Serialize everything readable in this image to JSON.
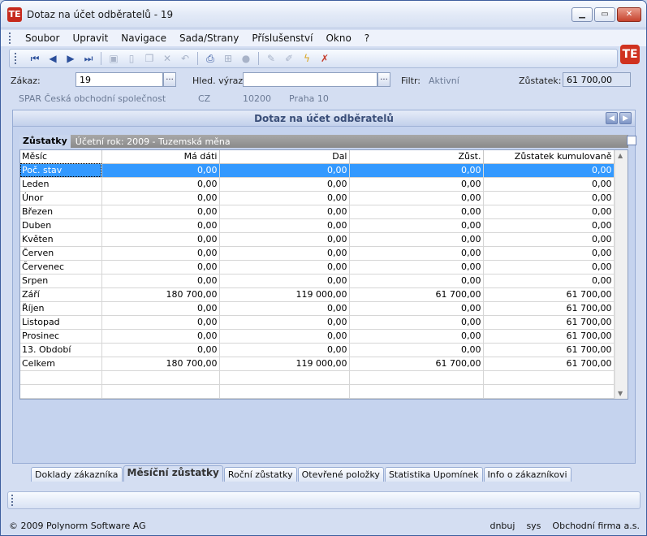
{
  "window": {
    "title": "Dotaz na účet odběratelů - 19",
    "logo": "TE"
  },
  "menu": [
    "Soubor",
    "Upravit",
    "Navigace",
    "Sada/Strany",
    "Příslušenství",
    "Okno",
    "?"
  ],
  "filters": {
    "zakaz_label": "Zákaz:",
    "zakaz_value": "19",
    "hled_label": "Hled. výraz:",
    "hled_value": "",
    "filtr_label": "Filtr:",
    "filtr_value": "Aktivní",
    "zustatek_label": "Zůstatek:",
    "zustatek_value": "61 700,00",
    "dots": "..."
  },
  "customer": {
    "name": "SPAR Česká obchodní společnost",
    "country": "CZ",
    "zip": "10200",
    "city": "Praha 10"
  },
  "panel": {
    "title": "Dotaz na účet odběratelů"
  },
  "section": {
    "title": "Zůstatky",
    "subtitle": "Účetní rok: 2009  -  Tuzemská měna"
  },
  "table": {
    "columns": [
      "Měsíc",
      "Má dáti",
      "Dal",
      "Zůst.",
      "Zůstatek kumulovaně"
    ],
    "rows": [
      [
        "Poč. stav",
        "0,00",
        "0,00",
        "0,00",
        "0,00"
      ],
      [
        "Leden",
        "0,00",
        "0,00",
        "0,00",
        "0,00"
      ],
      [
        "Únor",
        "0,00",
        "0,00",
        "0,00",
        "0,00"
      ],
      [
        "Březen",
        "0,00",
        "0,00",
        "0,00",
        "0,00"
      ],
      [
        "Duben",
        "0,00",
        "0,00",
        "0,00",
        "0,00"
      ],
      [
        "Květen",
        "0,00",
        "0,00",
        "0,00",
        "0,00"
      ],
      [
        "Červen",
        "0,00",
        "0,00",
        "0,00",
        "0,00"
      ],
      [
        "Červenec",
        "0,00",
        "0,00",
        "0,00",
        "0,00"
      ],
      [
        "Srpen",
        "0,00",
        "0,00",
        "0,00",
        "0,00"
      ],
      [
        "Září",
        "180 700,00",
        "119 000,00",
        "61 700,00",
        "61 700,00"
      ],
      [
        "Říjen",
        "0,00",
        "0,00",
        "0,00",
        "61 700,00"
      ],
      [
        "Listopad",
        "0,00",
        "0,00",
        "0,00",
        "61 700,00"
      ],
      [
        "Prosinec",
        "0,00",
        "0,00",
        "0,00",
        "61 700,00"
      ],
      [
        "13. Období",
        "0,00",
        "0,00",
        "0,00",
        "61 700,00"
      ],
      [
        "Celkem",
        "180 700,00",
        "119 000,00",
        "61 700,00",
        "61 700,00"
      ]
    ]
  },
  "tabs": [
    {
      "label": "Doklady zákazníka"
    },
    {
      "label": "Měsíční zůstatky"
    },
    {
      "label": "Roční zůstatky"
    },
    {
      "label": "Otevřené položky"
    },
    {
      "label": "Statistika Upomínek"
    },
    {
      "label": "Info o zákazníkovi"
    }
  ],
  "status": {
    "copyright": "© 2009 Polynorm Software AG",
    "user": "dnbuj",
    "system": "sys",
    "company": "Obchodní firma a.s."
  }
}
